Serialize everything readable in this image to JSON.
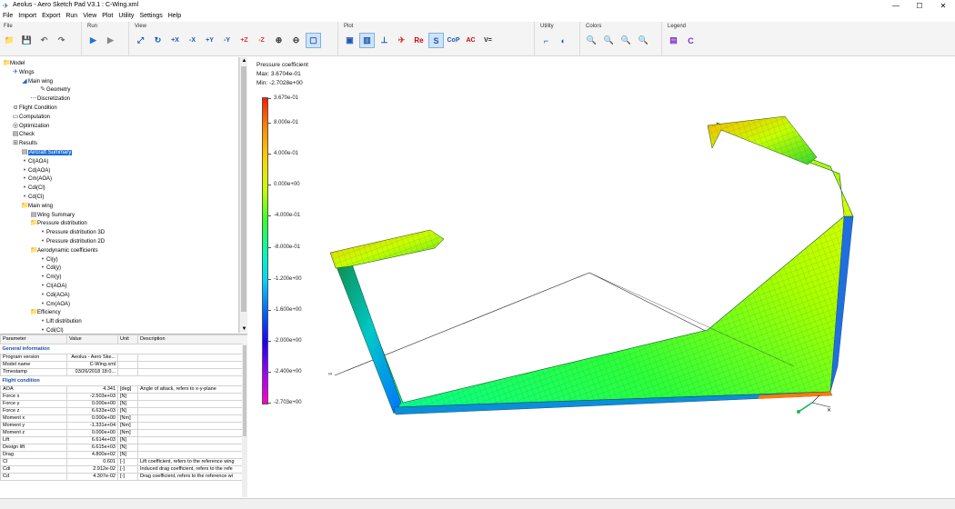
{
  "window": {
    "title": "Aeolus - Aero Sketch Pad V3.1 : C-Wing.xml",
    "controls": [
      "—",
      "☐",
      "✕"
    ]
  },
  "menu": [
    "File",
    "Import",
    "Export",
    "Run",
    "View",
    "Plot",
    "Utility",
    "Settings",
    "Help"
  ],
  "ribbon": {
    "groups": [
      {
        "label": "File",
        "buttons": [
          "📁",
          "💾",
          "↶",
          "↷"
        ]
      },
      {
        "label": "Run",
        "buttons": [
          "▶",
          "▶"
        ]
      },
      {
        "label": "View",
        "buttons": [
          "⤢",
          "↻",
          "+X",
          "-X",
          "+Y",
          "-Y",
          "+Z",
          "-Z",
          "⊕",
          "⊖",
          "▢"
        ]
      },
      {
        "label": "Plot",
        "buttons": [
          "▣",
          "▥",
          "⊥",
          "✈",
          "Re",
          "S",
          "CoP",
          "AC",
          "V="
        ]
      },
      {
        "label": "Utility",
        "buttons": [
          "⌐",
          "◐"
        ]
      },
      {
        "label": "Colors",
        "buttons": [
          "🔍",
          "🔍",
          "🔍",
          "🔍"
        ]
      },
      {
        "label": "Legend",
        "buttons": [
          "▤",
          "C"
        ]
      }
    ]
  },
  "tree": [
    {
      "label": "Model",
      "icon": "folder"
    },
    {
      "label": "Wings",
      "icon": "plane"
    },
    {
      "label": "Main wing",
      "icon": "wing"
    },
    {
      "label": "Geometry",
      "icon": "pencil"
    },
    {
      "label": "Discretization",
      "icon": "mesh"
    },
    {
      "label": "Flight Condition",
      "icon": "alpha"
    },
    {
      "label": "Computation",
      "icon": "window"
    },
    {
      "label": "Optimization",
      "icon": "target"
    },
    {
      "label": "Check",
      "icon": "doc"
    },
    {
      "label": "Results",
      "icon": "chart"
    },
    {
      "label": "Aircraft Summary",
      "icon": "doc"
    },
    {
      "label": "Cl(AOA)",
      "icon": "dot"
    },
    {
      "label": "Cd(AOA)",
      "icon": "dot"
    },
    {
      "label": "Cm(AOA)",
      "icon": "dot"
    },
    {
      "label": "Cdi(Cl)",
      "icon": "dot"
    },
    {
      "label": "Cd(Cl)",
      "icon": "dot"
    },
    {
      "label": "Main wing",
      "icon": "folder"
    },
    {
      "label": "Wing Summary",
      "icon": "doc"
    },
    {
      "label": "Pressure distribution",
      "icon": "folder"
    },
    {
      "label": "Pressure distribution 3D",
      "icon": "dot"
    },
    {
      "label": "Pressure distribution 2D",
      "icon": "dot"
    },
    {
      "label": "Aerodynamic coefficients",
      "icon": "folder"
    },
    {
      "label": "Cl(y)",
      "icon": "dot"
    },
    {
      "label": "Cdi(y)",
      "icon": "dot"
    },
    {
      "label": "Cm(y)",
      "icon": "dot"
    },
    {
      "label": "Cl(AOA)",
      "icon": "dot"
    },
    {
      "label": "Cdi(AOA)",
      "icon": "dot"
    },
    {
      "label": "Cm(AOA)",
      "icon": "dot"
    },
    {
      "label": "Efficiency",
      "icon": "folder"
    },
    {
      "label": "Lift distribution",
      "icon": "dot"
    },
    {
      "label": "Cdi(Cl)",
      "icon": "dot"
    }
  ],
  "properties": {
    "headers": [
      "Parameter",
      "Value",
      "Unit",
      "Description"
    ],
    "sections": [
      {
        "title": "General information",
        "rows": [
          [
            "Program version",
            "Aeolus - Aero Ske...",
            "",
            ""
          ],
          [
            "Model name",
            "C-Wing.xml",
            "",
            ""
          ],
          [
            "Timestamp",
            "03/26/2018 18:0...",
            "",
            ""
          ]
        ]
      },
      {
        "title": "Flight condition",
        "rows": [
          [
            "AOA",
            "4.341",
            "[deg]",
            "Angle of attack, refers to x-y-plane"
          ],
          [
            "Force x",
            "-2.503e+03",
            "[N]",
            ""
          ],
          [
            "Force y",
            "0.000e+00",
            "[N]",
            ""
          ],
          [
            "Force z",
            "6.633e+03",
            "[N]",
            ""
          ],
          [
            "Moment x",
            "0.000e+00",
            "[Nm]",
            ""
          ],
          [
            "Moment y",
            "-1.331e+04",
            "[Nm]",
            ""
          ],
          [
            "Moment z",
            "0.000e+00",
            "[Nm]",
            ""
          ],
          [
            "Lift",
            "6.614e+03",
            "[N]",
            ""
          ],
          [
            "Design lift",
            "6.615e+03",
            "[N]",
            ""
          ],
          [
            "Drag",
            "4.800e+02",
            "[N]",
            ""
          ],
          [
            "Cl",
            "0.601",
            "[-]",
            "Lift coefficient, refers to the reference wing"
          ],
          [
            "Cdi",
            "2.912e-02",
            "[-]",
            "Induced drag coefficient, refers to the refe"
          ],
          [
            "Cd",
            "4.307e-02",
            "[-]",
            "Drag coefficient, refers to the reference wi"
          ]
        ]
      }
    ]
  },
  "viewport": {
    "legend_title": "Pressure coefficient",
    "max_label": "Max: 3.6704e-01",
    "min_label": "Min: -2.7028e+00",
    "ticks": [
      "3.670e-01",
      "8.000e-01",
      "4.000e-01",
      "0.000e+00",
      "-4.000e-01",
      "-8.000e-01",
      "-1.200e+00",
      "-1.600e+00",
      "-2.000e+00",
      "-2.400e+00",
      "-2.703e+00"
    ]
  }
}
